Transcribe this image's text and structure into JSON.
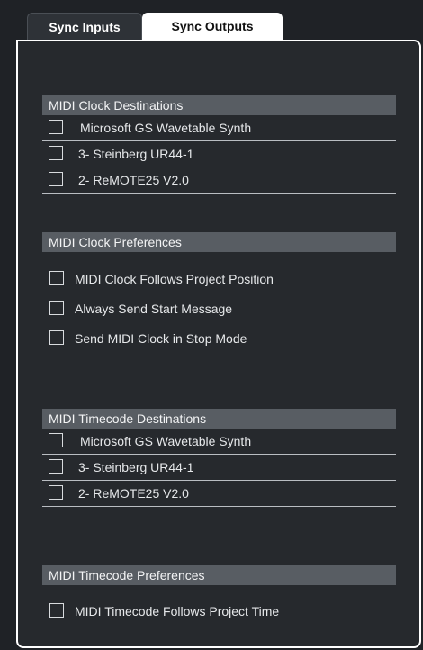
{
  "tabs": {
    "sync_inputs": "Sync Inputs",
    "sync_outputs": "Sync Outputs"
  },
  "midi_clock_destinations": {
    "title": "MIDI Clock Destinations",
    "items": [
      "Microsoft GS Wavetable Synth",
      "3- Steinberg UR44-1",
      "2- ReMOTE25 V2.0"
    ]
  },
  "midi_clock_preferences": {
    "title": "MIDI Clock Preferences",
    "items": [
      "MIDI Clock Follows Project Position",
      "Always Send Start Message",
      "Send MIDI Clock in Stop Mode"
    ]
  },
  "midi_timecode_destinations": {
    "title": "MIDI Timecode Destinations",
    "items": [
      "Microsoft GS Wavetable Synth",
      "3- Steinberg UR44-1",
      "2- ReMOTE25 V2.0"
    ]
  },
  "midi_timecode_preferences": {
    "title": "MIDI Timecode Preferences",
    "items": [
      "MIDI Timecode Follows Project Time"
    ]
  }
}
